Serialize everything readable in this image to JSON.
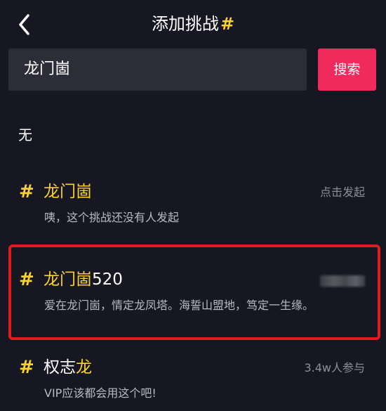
{
  "header": {
    "title": "添加挑战",
    "title_hash": "#",
    "back_icon": "chevron-left-icon"
  },
  "search": {
    "value": "龙门崮",
    "button_label": "搜索"
  },
  "result_note": "无",
  "items": [
    {
      "hash": "#",
      "title_highlight": "龙门崮",
      "title_plain": "",
      "meta": "点击发起",
      "description": "咦，这个挑战还没有人发起"
    },
    {
      "hash": "#",
      "title_highlight": "龙门崮",
      "title_plain": "520",
      "meta": "",
      "description": "爱在龙门崮，情定龙凤塔。海誓山盟地，笃定一生缘。"
    },
    {
      "hash": "#",
      "title_plain": "权志",
      "title_highlight": "龙",
      "meta": "3.4w人参与",
      "description": "VIP应该都会用这个吧!"
    }
  ],
  "colors": {
    "background": "#161722",
    "accent_yellow": "#f9d22b",
    "search_button": "#f02a5c",
    "highlight_border": "#e11b1e",
    "input_bg": "#2c2d38"
  }
}
